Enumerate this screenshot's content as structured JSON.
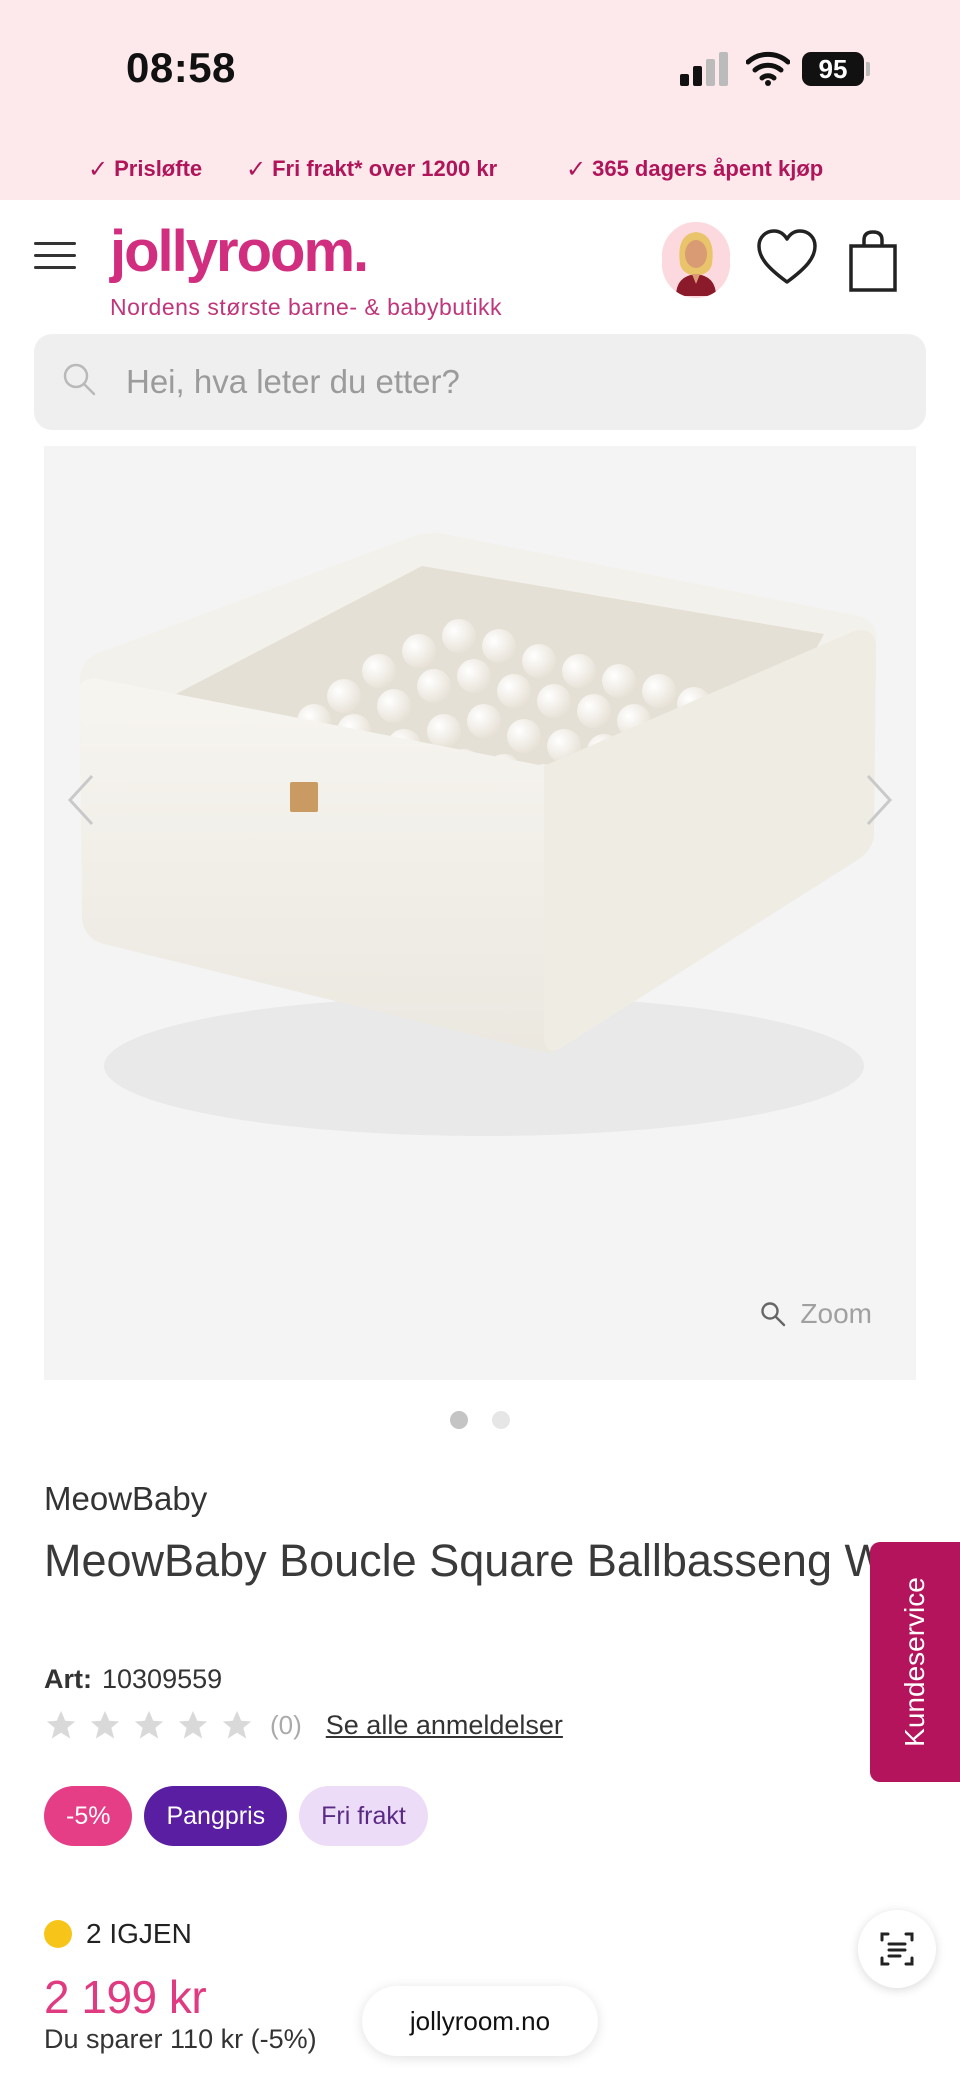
{
  "status_bar": {
    "time": "08:58",
    "battery": "95"
  },
  "usp_strip": {
    "items": [
      "Prisløfte",
      "Fri frakt* over 1200 kr",
      "365 dagers åpent kjøp"
    ]
  },
  "header": {
    "logo": "jollyroom.",
    "tagline": "Nordens største barne- & babybutikk",
    "icons": [
      "menu-icon",
      "avatar",
      "heart-icon",
      "bag-icon"
    ]
  },
  "search": {
    "placeholder": "Hei, hva leter du etter?"
  },
  "gallery": {
    "zoom_label": "Zoom",
    "image_count": 2,
    "active_index": 0
  },
  "product": {
    "brand": "MeowBaby",
    "title": "MeowBaby Boucle Square Ballbasseng White/White Pearl",
    "art_label": "Art:",
    "art_number": "10309559",
    "rating": 0,
    "rating_max": 5,
    "review_count": "(0)",
    "reviews_link": "Se alle anmeldelser",
    "badges": [
      "-5%",
      "Pangpris",
      "Fri frakt"
    ],
    "stock": "2 IGJEN",
    "price": "2 199 kr",
    "savings": "Du sparer 110 kr (-5%)"
  },
  "customer_service": {
    "label": "Kundeservice"
  },
  "browser": {
    "url": "jollyroom.no"
  },
  "colors": {
    "brand_pink": "#d12e7f",
    "price_pink": "#e03b81",
    "service_tab": "#b3145b",
    "badge_discount": "#e53d86",
    "badge_pangpris": "#5a1ea3",
    "badge_frifrakt": "#eddcf7",
    "stock_dot": "#f7c519"
  }
}
